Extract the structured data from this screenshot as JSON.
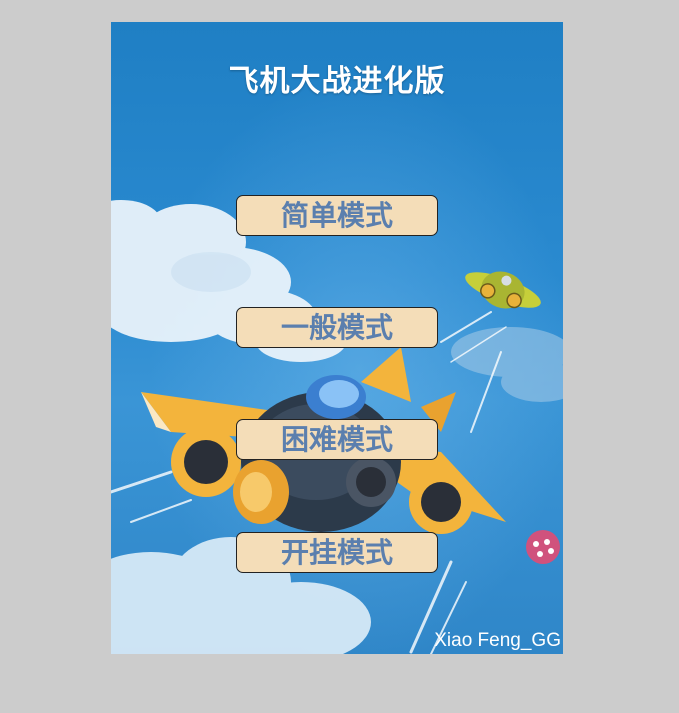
{
  "game": {
    "title": "飞机大战进化版",
    "modes": [
      {
        "label": "简单模式"
      },
      {
        "label": "一般模式"
      },
      {
        "label": "困难模式"
      },
      {
        "label": "开挂模式"
      }
    ],
    "credit": "Xiao Feng_GG"
  },
  "colors": {
    "page_background": "#cccccc",
    "sky": "#2a8ad0",
    "button_fill": "#f4ddb8",
    "button_text": "#5b7fae",
    "title_text": "#ffffff"
  },
  "icons": [
    "player-plane-icon",
    "enemy-plane-icon",
    "enemy-creature-icon",
    "cloud-icon"
  ]
}
